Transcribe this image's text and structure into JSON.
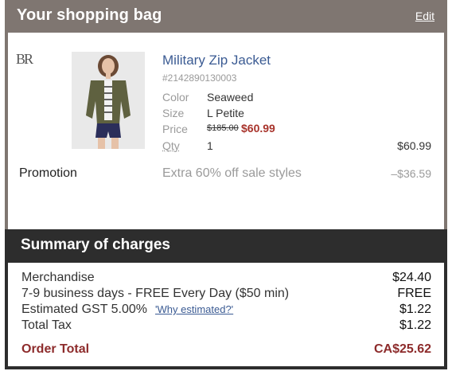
{
  "bag": {
    "title": "Your shopping bag",
    "edit_label": "Edit",
    "brand_logo": "BR",
    "item": {
      "name": "Military Zip Jacket",
      "sku": "#2142890130003",
      "color_label": "Color",
      "color_value": "Seaweed",
      "size_label": "Size",
      "size_value": "L Petite",
      "price_label": "Price",
      "price_original": "$185.00",
      "price_sale": "$60.99",
      "qty_label": "Qty",
      "qty_value": "1",
      "line_total": "$60.99"
    },
    "promotion": {
      "label": "Promotion",
      "description": "Extra 60% off sale styles",
      "amount": "–$36.59"
    }
  },
  "summary": {
    "title": "Summary of charges",
    "rows": [
      {
        "label": "Merchandise",
        "value": "$24.40"
      },
      {
        "label": "7-9 business days - FREE Every Day ($50 min)",
        "value": "FREE"
      },
      {
        "label": "Estimated GST 5.00%",
        "link": "'Why estimated?'",
        "value": "$1.22"
      },
      {
        "label": "Total Tax",
        "value": "$1.22"
      }
    ],
    "total_label": "Order Total",
    "total_value": "CA$25.62"
  },
  "colors": {
    "bag_header": "#7f7671",
    "summary_header": "#2d2d2d",
    "link": "#3b5b93",
    "sale_price": "#a8332b",
    "order_total": "#8d2b2b"
  }
}
